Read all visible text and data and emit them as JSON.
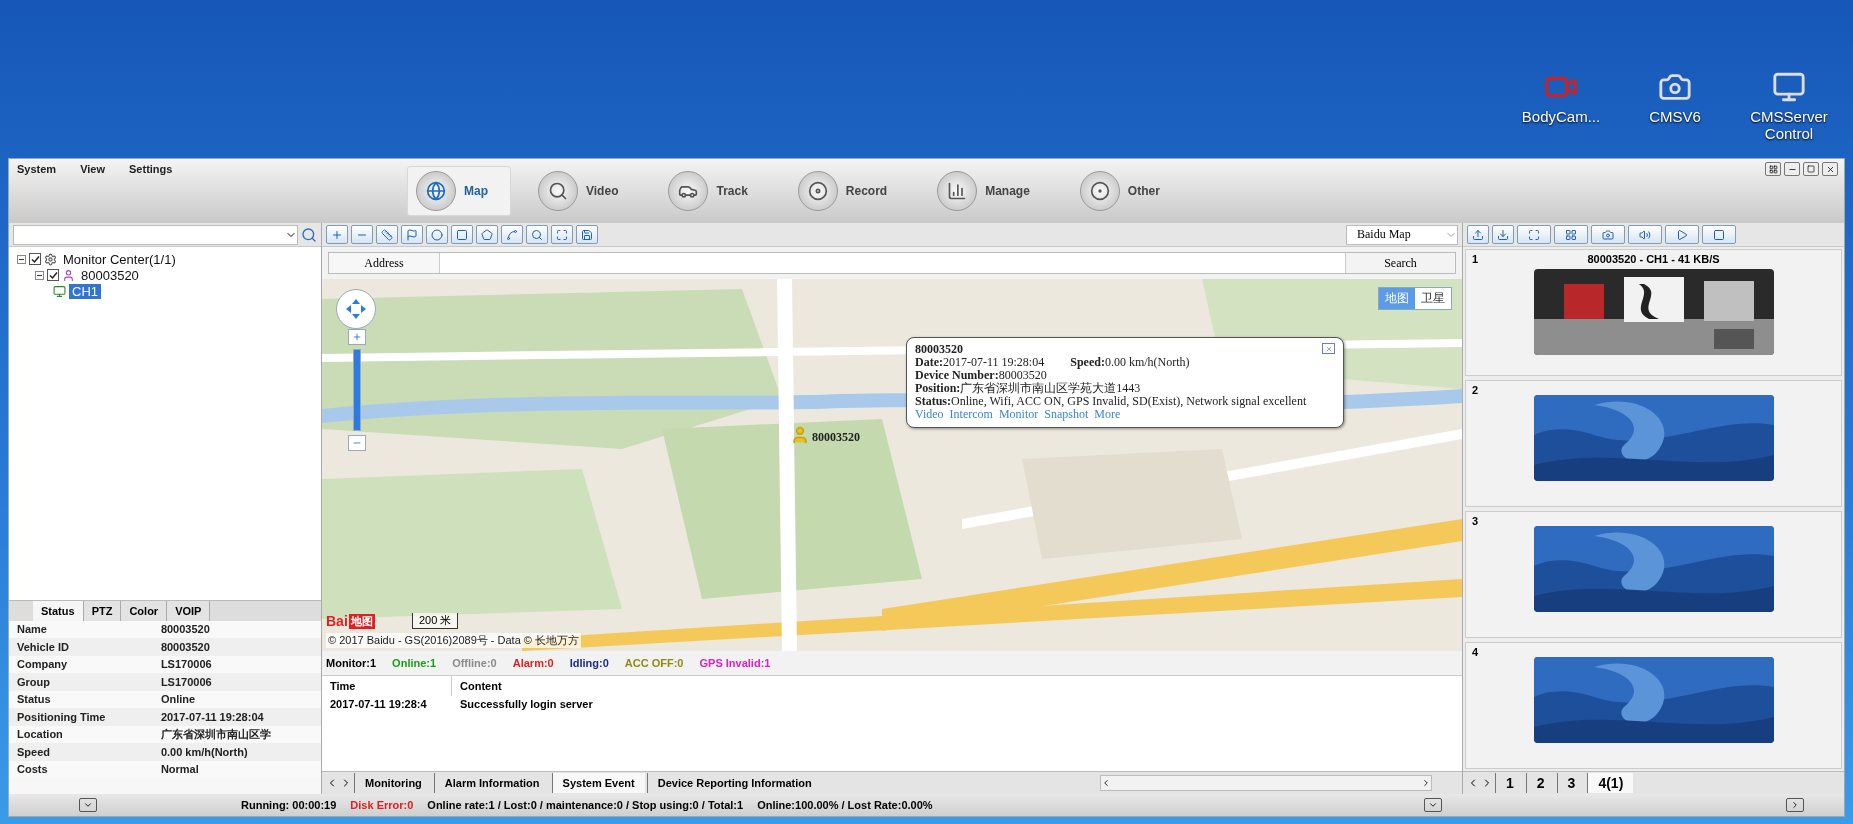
{
  "desktop_icons": [
    {
      "label": "BodyCam...",
      "kind": "bodycam"
    },
    {
      "label": "CMSV6",
      "kind": "camera"
    },
    {
      "label": "CMSServer Control",
      "kind": "server"
    }
  ],
  "menu": [
    "System",
    "View",
    "Settings"
  ],
  "nav_tabs": [
    {
      "label": "Map",
      "selected": true
    },
    {
      "label": "Video",
      "selected": false
    },
    {
      "label": "Track",
      "selected": false
    },
    {
      "label": "Record",
      "selected": false
    },
    {
      "label": "Manage",
      "selected": false
    },
    {
      "label": "Other",
      "selected": false
    }
  ],
  "tree": [
    {
      "label": "Monitor Center(1/1)",
      "kind": "group",
      "checked": true,
      "expanded": true,
      "selected": false,
      "children": [
        {
          "label": "80003520",
          "kind": "vehicle",
          "checked": true,
          "expanded": true,
          "selected": false,
          "children": [
            {
              "label": "CH1",
              "kind": "channel",
              "selected": true
            }
          ]
        }
      ]
    }
  ],
  "info_tabs": [
    {
      "label": "Status",
      "selected": true
    },
    {
      "label": "PTZ",
      "selected": false
    },
    {
      "label": "Color",
      "selected": false
    },
    {
      "label": "VOIP",
      "selected": false
    }
  ],
  "info_rows": [
    {
      "label": "Name",
      "value": "80003520"
    },
    {
      "label": "Vehicle ID",
      "value": "80003520"
    },
    {
      "label": "Company",
      "value": "LS170006"
    },
    {
      "label": "Group",
      "value": "LS170006"
    },
    {
      "label": "Status",
      "value": "Online"
    },
    {
      "label": "Positioning Time",
      "value": "2017-07-11 19:28:04"
    },
    {
      "label": "Location",
      "value": "广东省深圳市南山区学"
    },
    {
      "label": "Speed",
      "value": "0.00 km/h(North)"
    },
    {
      "label": "Costs",
      "value": "Normal"
    }
  ],
  "map": {
    "provider": "Baidu Map",
    "address_label": "Address",
    "search_button": "Search",
    "map_types": [
      {
        "label": "地图",
        "selected": true
      },
      {
        "label": "卫星",
        "selected": false
      }
    ],
    "logo": [
      "Bai",
      "地图"
    ],
    "scale": "200 米",
    "copyright": "© 2017 Baidu - GS(2016)2089号 - Data © 长地万方",
    "marker": {
      "label": "80003520"
    },
    "popup": {
      "title": "80003520",
      "lines": [
        [
          {
            "label": "Date:",
            "value": "2017-07-11 19:28:04"
          },
          {
            "label": "Speed:",
            "value": "0.00 km/h(North)"
          }
        ],
        [
          {
            "label": "Device Number:",
            "value": "80003520"
          }
        ],
        [
          {
            "label": "Position:",
            "value": "广东省深圳市南山区学苑大道1443"
          }
        ],
        [
          {
            "label": "Status:",
            "value": "Online, Wifi, ACC ON, GPS Invalid, SD(Exist), Network signal excellent"
          }
        ]
      ],
      "links": [
        "Video",
        "Intercom",
        "Monitor",
        "Snapshot",
        "More"
      ]
    }
  },
  "monitor_counts": [
    {
      "label": "Monitor:1",
      "color": "#000000"
    },
    {
      "label": "Online:1",
      "color": "#1a9e1a"
    },
    {
      "label": "Offline:0",
      "color": "#8a8a8a"
    },
    {
      "label": "Alarm:0",
      "color": "#e02020"
    },
    {
      "label": "Idling:0",
      "color": "#1c2a8c"
    },
    {
      "label": "ACC OFF:0",
      "color": "#8c8c10"
    },
    {
      "label": "GPS Invalid:1",
      "color": "#e020c0"
    }
  ],
  "events": {
    "columns": [
      "Time",
      "Content"
    ],
    "rows": [
      [
        "2017-07-11 19:28:4",
        "Successfully login server"
      ]
    ]
  },
  "bottom_tabs": [
    {
      "label": "Monitoring",
      "selected": false
    },
    {
      "label": "Alarm Information",
      "selected": false
    },
    {
      "label": "System Event",
      "selected": true
    },
    {
      "label": "Device Reporting Information",
      "selected": false
    }
  ],
  "video_tiles": [
    {
      "number": "1",
      "title": "80003520 - CH1 - 41 KB/S",
      "kind": "camera"
    },
    {
      "number": "2",
      "kind": "idle"
    },
    {
      "number": "3",
      "kind": "idle"
    },
    {
      "number": "4",
      "kind": "idle"
    }
  ],
  "video_pages": [
    {
      "label": "1",
      "selected": false
    },
    {
      "label": "2",
      "selected": false
    },
    {
      "label": "3",
      "selected": false
    },
    {
      "label": "4(1)",
      "selected": true
    }
  ],
  "status_bar": [
    {
      "text": "Running: 00:00:19",
      "color": "#000000"
    },
    {
      "text": "Disk Error:0",
      "color": "#e02020"
    },
    {
      "text": "Online rate:1 / Lost:0 / maintenance:0 / Stop using:0 / Total:1",
      "color": "#000000"
    },
    {
      "text": "Online:100.00% / Lost Rate:0.00%",
      "color": "#000000"
    }
  ]
}
